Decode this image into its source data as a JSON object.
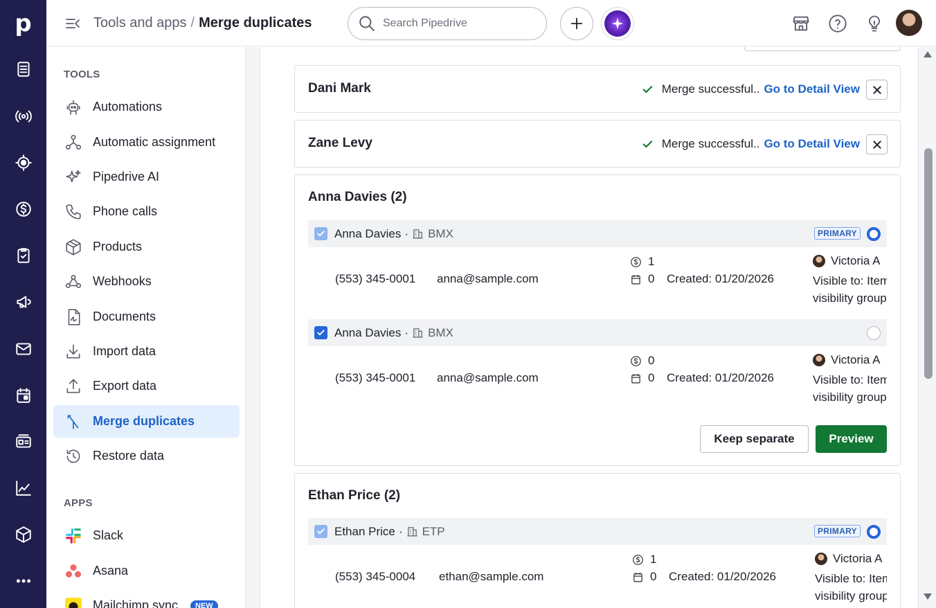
{
  "app": {
    "logo": "p"
  },
  "header": {
    "breadcrumb_parent": "Tools and apps",
    "breadcrumb_sep": "/",
    "breadcrumb_current": "Merge duplicates",
    "search_placeholder": "Search Pipedrive"
  },
  "rail_icons": [
    "leads-icon",
    "campaigns-signal-icon",
    "deals-target-icon",
    "money-icon",
    "activities-icon",
    "megaphone-icon",
    "mail-icon",
    "calendar-icon",
    "contacts-card-icon",
    "insights-chart-icon",
    "products-box-icon",
    "more-icon"
  ],
  "sidebar": {
    "tools_heading": "TOOLS",
    "apps_heading": "APPS",
    "tools": [
      {
        "label": "Automations",
        "icon": "automations-icon"
      },
      {
        "label": "Automatic assignment",
        "icon": "assignment-icon"
      },
      {
        "label": "Pipedrive AI",
        "icon": "sparkle-icon"
      },
      {
        "label": "Phone calls",
        "icon": "phone-icon"
      },
      {
        "label": "Products",
        "icon": "box-icon"
      },
      {
        "label": "Webhooks",
        "icon": "webhook-icon"
      },
      {
        "label": "Documents",
        "icon": "document-icon"
      },
      {
        "label": "Import data",
        "icon": "download-icon"
      },
      {
        "label": "Export data",
        "icon": "upload-icon"
      },
      {
        "label": "Merge duplicates",
        "icon": "merge-icon"
      },
      {
        "label": "Restore data",
        "icon": "restore-icon"
      }
    ],
    "active_tool": "Merge duplicates",
    "apps": [
      {
        "label": "Slack",
        "icon": "slack-logo-icon"
      },
      {
        "label": "Asana",
        "icon": "asana-logo-icon"
      },
      {
        "label": "Mailchimp sync",
        "icon": "mailchimp-logo-icon",
        "badge": "NEW"
      }
    ]
  },
  "merged": [
    {
      "name": "Dani Mark",
      "status": "Merge successful..",
      "link": "Go to Detail View"
    },
    {
      "name": "Zane Levy",
      "status": "Merge successful..",
      "link": "Go to Detail View"
    }
  ],
  "groups": [
    {
      "title": "Anna Davies (2)",
      "actions": {
        "keep_separate": "Keep separate",
        "preview": "Preview"
      },
      "records": [
        {
          "checked_style": "light",
          "name": "Anna Davies",
          "separator": "·",
          "org": "BMX",
          "primary_label": "PRIMARY",
          "is_primary": true,
          "phone": "(553) 345-0001",
          "email": "anna@sample.com",
          "deals": "1",
          "activities": "0",
          "created": "Created: 01/20/2026",
          "owner": "Victoria A",
          "visible_line1": "Visible to: Item owner's",
          "visible_line2": "visibility group"
        },
        {
          "checked_style": "dark",
          "name": "Anna Davies",
          "separator": "·",
          "org": "BMX",
          "primary_label": "",
          "is_primary": false,
          "phone": "(553) 345-0001",
          "email": "anna@sample.com",
          "deals": "0",
          "activities": "0",
          "created": "Created: 01/20/2026",
          "owner": "Victoria A",
          "visible_line1": "Visible to: Item owner's",
          "visible_line2": "visibility group"
        }
      ]
    },
    {
      "title": "Ethan Price (2)",
      "records": [
        {
          "checked_style": "light",
          "name": "Ethan Price",
          "separator": "·",
          "org": "ETP",
          "primary_label": "PRIMARY",
          "is_primary": true,
          "phone": "(553) 345-0004",
          "email": "ethan@sample.com",
          "deals": "1",
          "activities": "0",
          "created": "Created: 01/20/2026",
          "owner": "Victoria A",
          "visible_line1": "Visible to: Item owner's",
          "visible_line2": "visibility group"
        }
      ]
    }
  ],
  "colors": {
    "rail": "#1f1e4c",
    "accent": "#1d63c6",
    "success": "#127833",
    "active_bg": "#e3effd"
  }
}
